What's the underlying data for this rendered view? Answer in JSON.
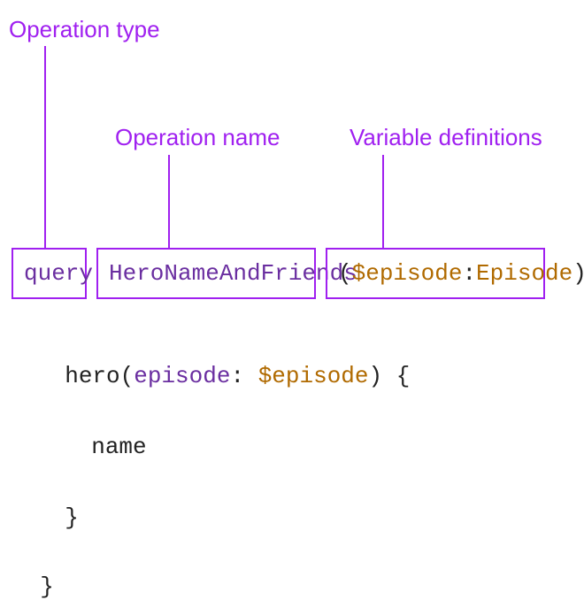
{
  "labels": {
    "operation_type": "Operation type",
    "operation_name": "Operation name",
    "variable_definitions": "Variable definitions"
  },
  "boxes": {
    "query_keyword": "query",
    "operation_name_value": "HeroNameAndFriends",
    "var_defs_open": "(",
    "var_defs_var": "$episode",
    "var_defs_colon": ": ",
    "var_defs_type": "Episode",
    "var_defs_close": ")"
  },
  "code": {
    "line1_brace": "{",
    "line2_field": "hero",
    "line2_paren_open": "(",
    "line2_argname": "episode",
    "line2_colon": ": ",
    "line2_argvar": "$episode",
    "line2_paren_close": ")",
    "line2_brace": " {",
    "line3_field": "name",
    "line4_brace": "}",
    "line5_brace": "}"
  }
}
